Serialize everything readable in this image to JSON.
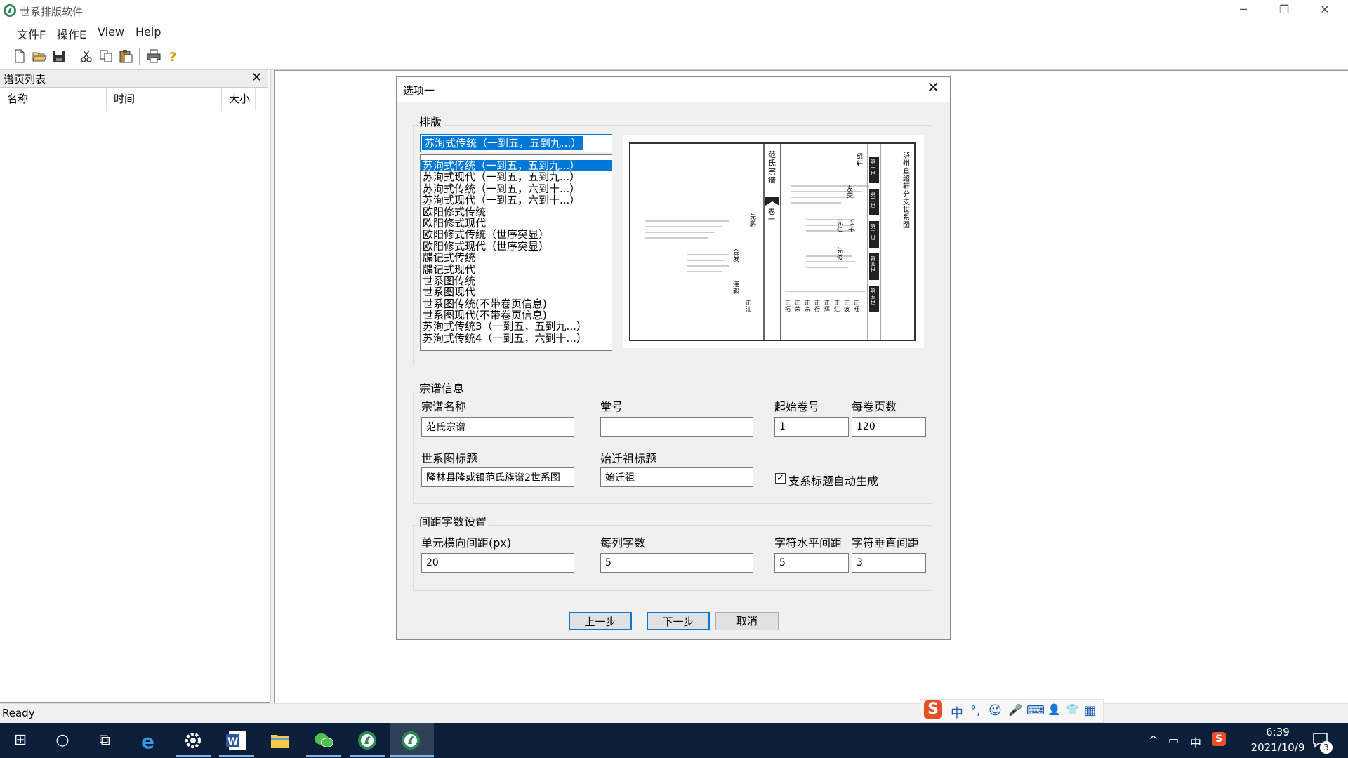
{
  "window": {
    "title": "世系排版软件",
    "controls": {
      "minimize": "─",
      "restore": "❐",
      "close": "✕"
    }
  },
  "menu": [
    "文件F",
    "操作E",
    "View",
    "Help"
  ],
  "toolbar_icons": [
    "new-file-icon",
    "open-folder-icon",
    "save-icon",
    "cut-icon",
    "copy-icon",
    "paste-icon",
    "print-icon",
    "help-icon"
  ],
  "left_pane": {
    "title": "谱页列表",
    "close": "✕",
    "columns": [
      "名称",
      "时间",
      "大小"
    ]
  },
  "dialog": {
    "title": "选项一",
    "close": "✕",
    "layout_group": {
      "title": "排版",
      "selected": "苏洵式传统（一到五，五到九...）",
      "items": [
        "苏洵式传统（一到五，五到九...）",
        "苏洵式现代（一到五，五到九...）",
        "苏洵式传统（一到五，六到十...）",
        "苏洵式现代（一到五，六到十...）",
        "欧阳修式传统",
        "欧阳修式现代",
        "欧阳修式传统（世序突显）",
        "欧阳修式现代（世序突显）",
        "牒记式传统",
        "牒记式现代",
        "世系图传统",
        "世系图现代",
        "世系图传统(不带卷页信息)",
        "世系图现代(不带卷页信息)",
        "苏洵式传统3（一到五，五到九...）",
        "苏洵式传统4（一到五，六到十...）"
      ],
      "preview": {
        "spine_title": "范氏宗谱",
        "volume": "卷一",
        "right_title": "泸州直绍轩分支世系图",
        "generation_labels": [
          "第一世",
          "第二世",
          "第三世",
          "第四世",
          "第五世"
        ],
        "names_top": [
          "绍轩",
          "友荣",
          "先仁",
          "长子",
          "先俊"
        ],
        "names_mid": [
          "先鹏",
          "金发",
          "连毅"
        ],
        "names_bottom": [
          "正拓",
          "正荣",
          "正宗",
          "正行",
          "正辉",
          "正红",
          "正波",
          "正旺",
          "正江"
        ]
      }
    },
    "genealogy_group": {
      "title": "宗谱信息",
      "name_label": "宗谱名称",
      "name_value": "范氏宗谱",
      "hall_label": "堂号",
      "hall_value": "",
      "start_volume_label": "起始卷号",
      "start_volume_value": "1",
      "pages_label": "每卷页数",
      "pages_value": "120",
      "tree_title_label": "世系图标题",
      "tree_title_value": "隆林县隆或镇范氏族谱2世系图",
      "ancestor_label": "始迁祖标题",
      "ancestor_value": "始迁祖",
      "auto_checkbox_label": "支系标题自动生成",
      "auto_checkbox_mark": "✓"
    },
    "spacing_group": {
      "title": "间距字数设置",
      "cell_spacing_label": "单元横向间距(px)",
      "cell_spacing_value": "20",
      "chars_per_col_label": "每列字数",
      "chars_per_col_value": "5",
      "char_h_label": "字符水平间距",
      "char_h_value": "5",
      "char_v_label": "字符垂直间距",
      "char_v_value": "3"
    },
    "buttons": {
      "prev": "上一步",
      "next": "下一步",
      "cancel": "取消"
    }
  },
  "status": "Ready",
  "ime": {
    "logo": "S",
    "lang": "中",
    "punct": "°,",
    "emoji": "☺",
    "voice": "🎤",
    "keyboard": "⌨",
    "user": "👤",
    "skin": "👕",
    "tools": "▦"
  },
  "taskbar": {
    "start": "⊞",
    "search": "○",
    "taskview": "⧉",
    "tray_lang": "中",
    "tray_caret": "^",
    "tray_battery": "▭",
    "time": "6:39",
    "date": "2021/10/9",
    "notifications": "3"
  }
}
